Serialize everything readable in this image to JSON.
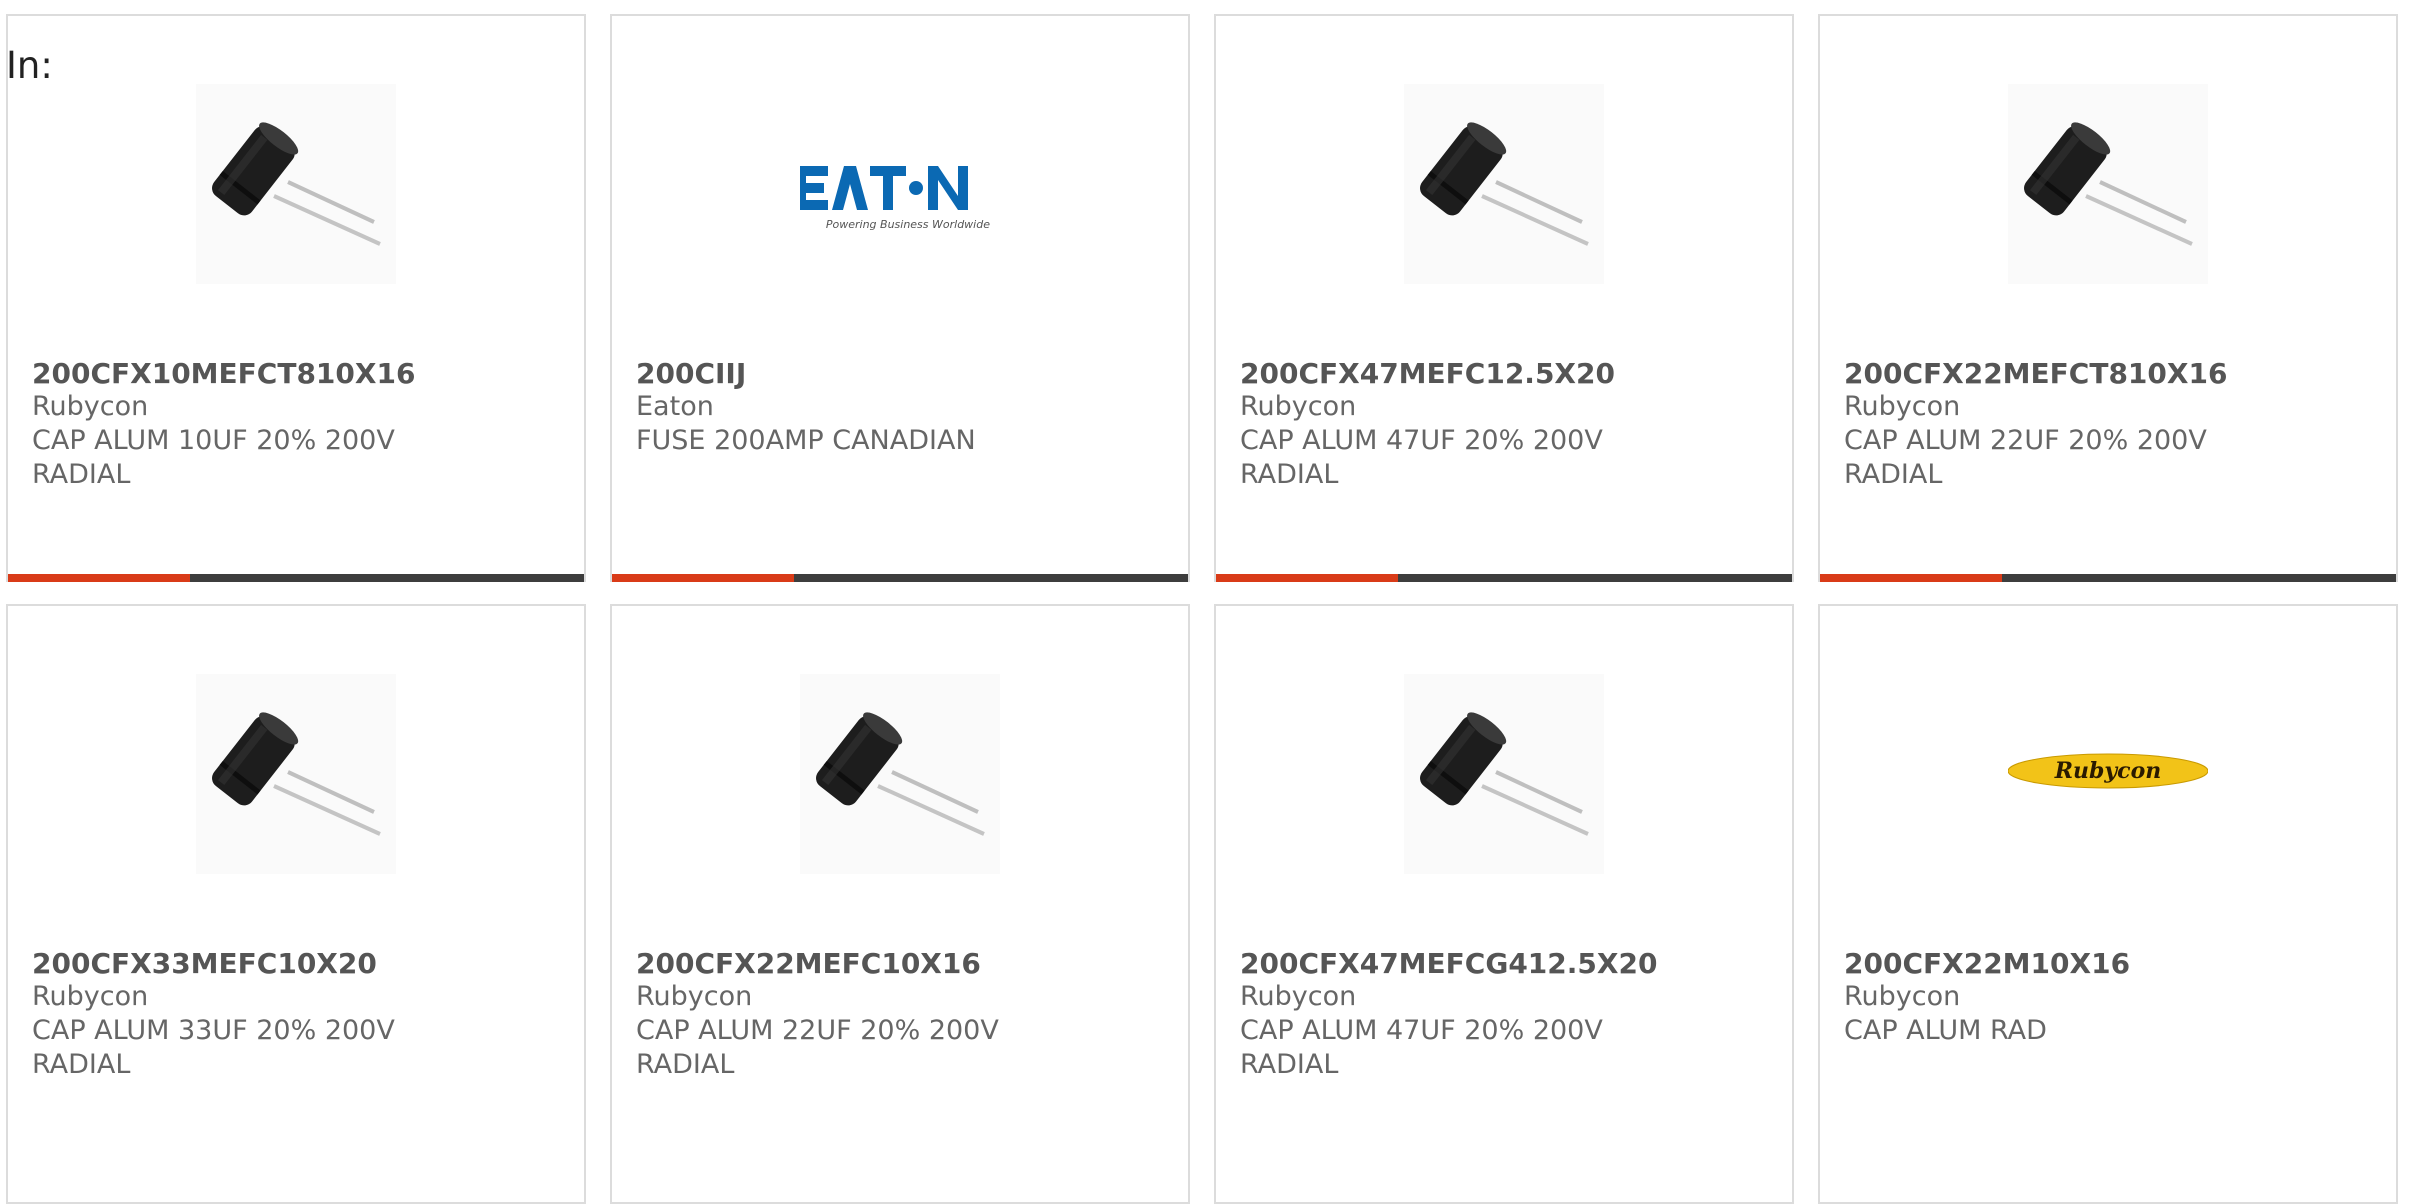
{
  "header": {
    "in_label": "In:"
  },
  "colors": {
    "accent": "#d93b18",
    "bar": "#3d3d3d",
    "eaton_blue": "#0b69b3",
    "rubycon_yellow": "#f2c318"
  },
  "products": [
    {
      "part": "200CFX10MEFCT810X16",
      "manufacturer": "Rubycon",
      "description": "CAP ALUM 10UF 20% 200V RADIAL",
      "image": "capacitor-image"
    },
    {
      "part": "200CIIJ",
      "manufacturer": "Eaton",
      "description": "FUSE 200AMP CANADIAN",
      "image": "eaton-logo",
      "logo_tagline": "Powering Business Worldwide"
    },
    {
      "part": "200CFX47MEFC12.5X20",
      "manufacturer": "Rubycon",
      "description": "CAP ALUM 47UF 20% 200V RADIAL",
      "image": "capacitor-image"
    },
    {
      "part": "200CFX22MEFCT810X16",
      "manufacturer": "Rubycon",
      "description": "CAP ALUM 22UF 20% 200V RADIAL",
      "image": "capacitor-image"
    },
    {
      "part": "200CFX33MEFC10X20",
      "manufacturer": "Rubycon",
      "description": "CAP ALUM 33UF 20% 200V RADIAL",
      "image": "capacitor-image"
    },
    {
      "part": "200CFX22MEFC10X16",
      "manufacturer": "Rubycon",
      "description": "CAP ALUM 22UF 20% 200V RADIAL",
      "image": "capacitor-image"
    },
    {
      "part": "200CFX47MEFCG412.5X20",
      "manufacturer": "Rubycon",
      "description": "CAP ALUM 47UF 20% 200V RADIAL",
      "image": "capacitor-image"
    },
    {
      "part": "200CFX22M10X16",
      "manufacturer": "Rubycon",
      "description": "CAP ALUM RAD",
      "image": "rubycon-logo",
      "logo_text": "Rubycon"
    }
  ]
}
